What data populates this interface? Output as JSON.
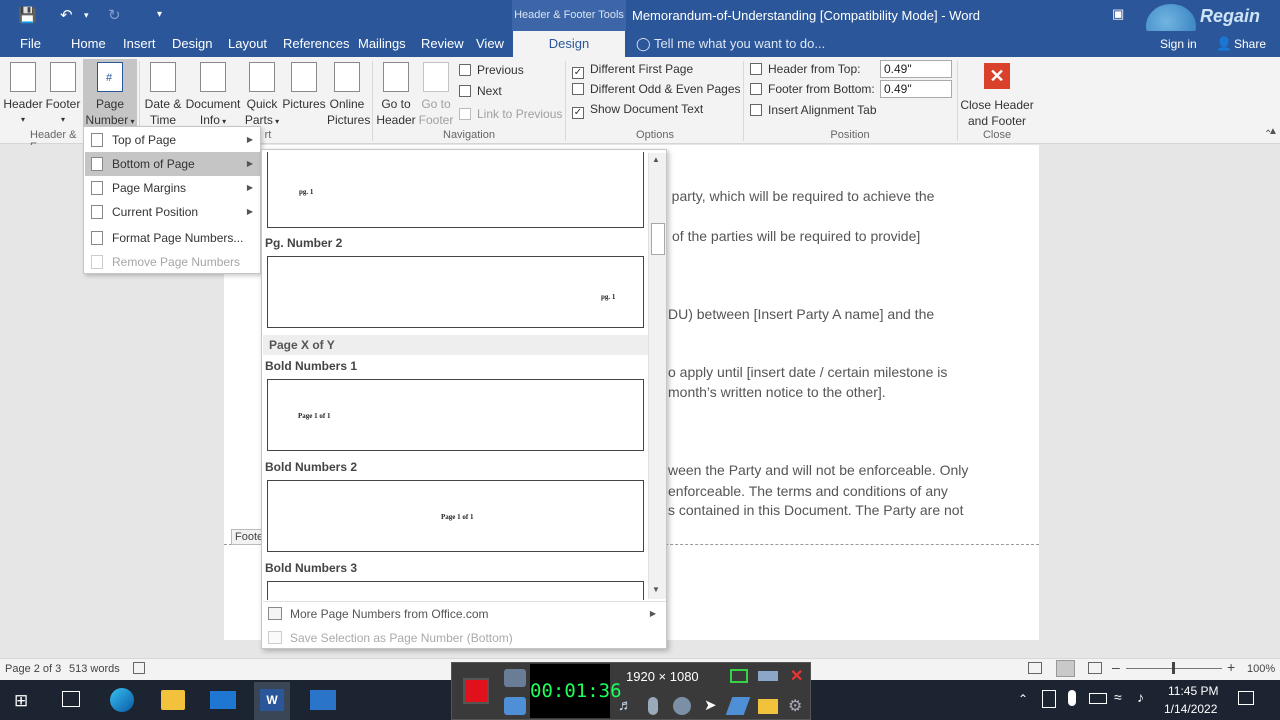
{
  "titlebar": {
    "contextual_group": "Header & Footer Tools",
    "document_title": "Memorandum-of-Understanding [Compatibility Mode] - Word",
    "sign_in": "Sign in",
    "share": "Share",
    "watermark": "Regain"
  },
  "tabs": [
    "File",
    "Home",
    "Insert",
    "Design",
    "Layout",
    "References",
    "Mailings",
    "Review",
    "View",
    "Design"
  ],
  "tell_me": "Tell me what you want to do...",
  "ribbon": {
    "header": "Header",
    "footer": "Footer",
    "page_number_line1": "Page",
    "page_number_line2": "Number",
    "group_header_footer": "Header & F",
    "date_time_line1": "Date &",
    "date_time_line2": "Time",
    "doc_info_line1": "Document",
    "doc_info_line2": "Info",
    "quick_parts_line1": "Quick",
    "quick_parts_line2": "Parts",
    "pictures": "Pictures",
    "online_pictures_line1": "Online",
    "online_pictures_line2": "Pictures",
    "group_insert": "rt",
    "goto_header_line1": "Go to",
    "goto_header_line2": "Header",
    "goto_footer_line1": "Go to",
    "goto_footer_line2": "Footer",
    "previous": "Previous",
    "next": "Next",
    "link_previous": "Link to Previous",
    "group_navigation": "Navigation",
    "different_first_page": "Different First Page",
    "different_odd_even": "Different Odd & Even Pages",
    "show_document_text": "Show Document Text",
    "group_options": "Options",
    "header_from_top": "Header from Top:",
    "header_from_top_value": "0.49\"",
    "footer_from_bottom": "Footer from Bottom:",
    "footer_from_bottom_value": "0.49\"",
    "insert_alignment_tab": "Insert Alignment Tab",
    "group_position": "Position",
    "close_line1": "Close Header",
    "close_line2": "and Footer",
    "group_close": "Close"
  },
  "page_number_menu": {
    "items": [
      {
        "label": "Top of Page"
      },
      {
        "label": "Bottom of Page"
      },
      {
        "label": "Page Margins"
      },
      {
        "label": "Current Position"
      },
      {
        "label": "Format Page Numbers..."
      },
      {
        "label": "Remove Page Numbers"
      }
    ]
  },
  "gallery": {
    "sample_top": "pg. 1",
    "pg_number_2": "Pg. Number 2",
    "sample_pg2": "pg. 1",
    "section_page_x_of_y": "Page X of Y",
    "bold_numbers_1": "Bold Numbers 1",
    "sample_bold1": "Page 1 of 1",
    "bold_numbers_2": "Bold Numbers 2",
    "sample_bold2": "Page 1 of 1",
    "bold_numbers_3": "Bold Numbers 3",
    "more_from_office": "More Page Numbers from Office.com",
    "save_selection": "Save Selection as Page Number (Bottom)"
  },
  "document": {
    "lines": [
      "h party, which will be required to achieve the",
      "of the parties will be required to provide]",
      "DU) between [Insert Party A name] and the",
      "o apply until [insert date / certain milestone is",
      "month’s written notice to the other].",
      "ween the Party and will not be enforceable. Only",
      "enforceable. The terms and conditions of any",
      "s contained in this Document. The Party are not"
    ],
    "footer_tag": "Footer"
  },
  "statusbar": {
    "page": "Page 2 of 3",
    "words": "513 words",
    "zoom": "100%"
  },
  "recorder": {
    "timer": "00:01:36",
    "resolution": "1920 × 1080"
  },
  "taskbar": {
    "time": "11:45 PM",
    "date": "1/14/2022"
  },
  "colors": {
    "word_blue": "#2b579a",
    "close_red": "#d9412b",
    "recorder_green": "#1dff5a"
  }
}
